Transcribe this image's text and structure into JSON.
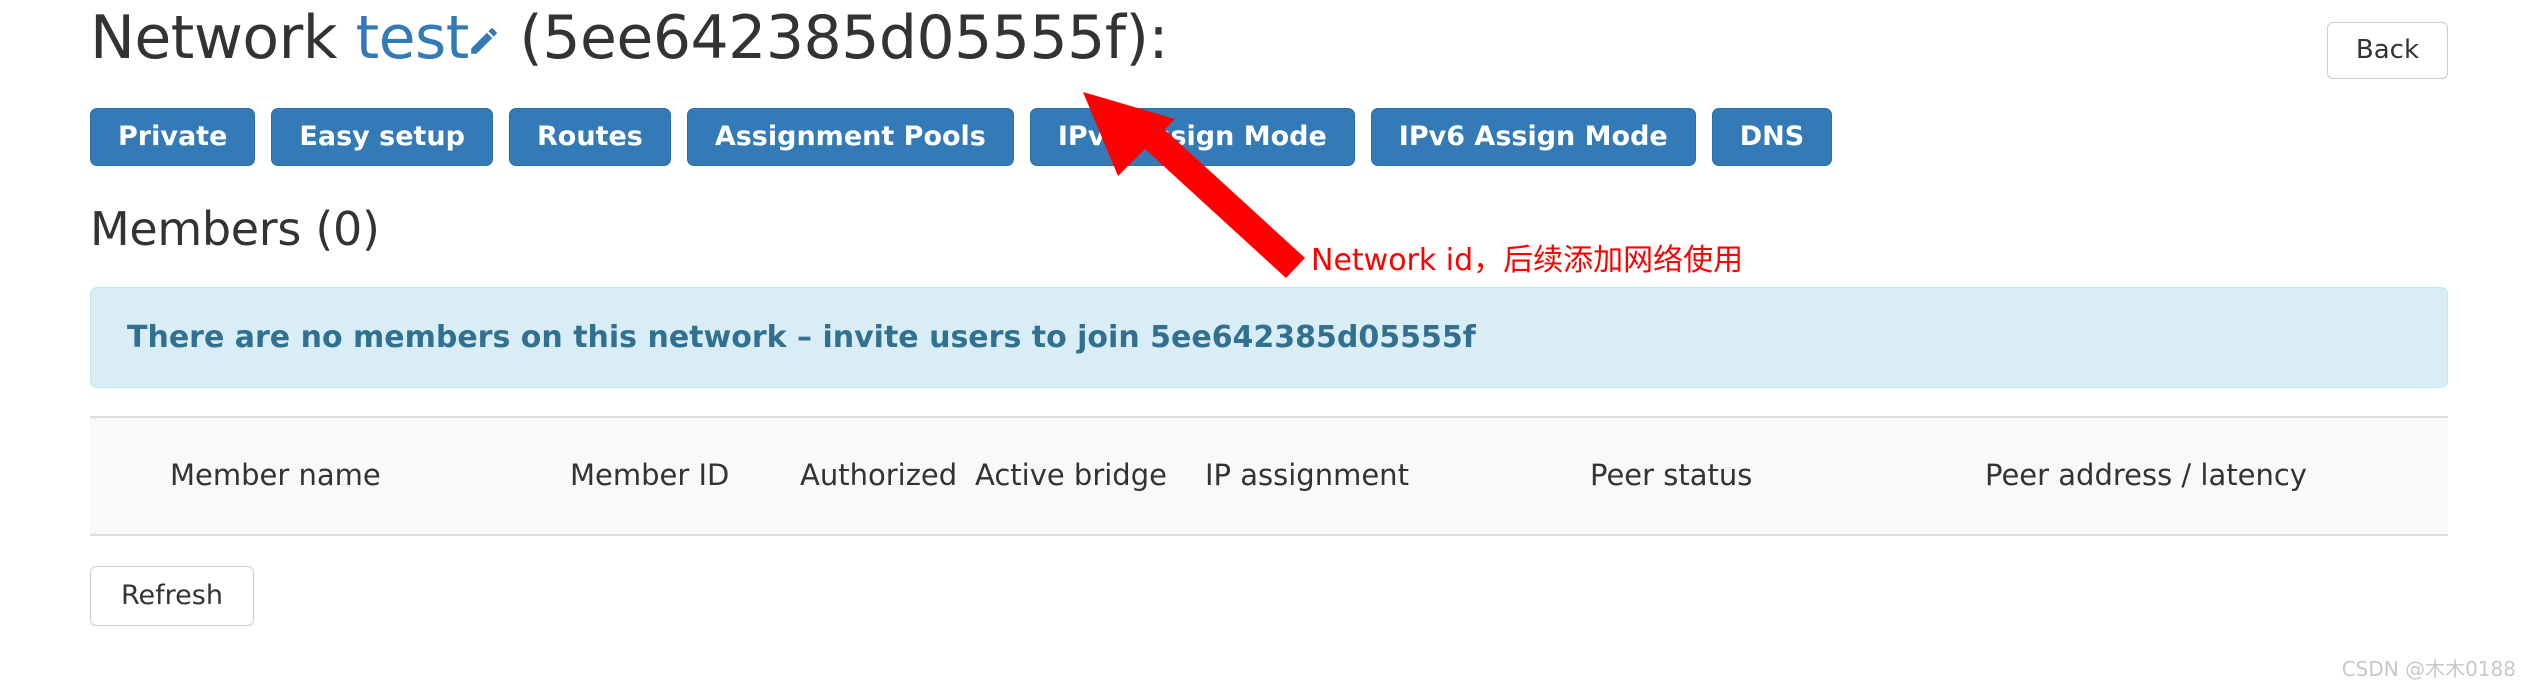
{
  "header": {
    "title_prefix": "Network",
    "network_name": "test",
    "edit_icon": "pencil-icon",
    "network_id_display": "(5ee642385d05555f):",
    "network_id": "5ee642385d05555f",
    "back_label": "Back"
  },
  "tabs": [
    {
      "label": "Private"
    },
    {
      "label": "Easy setup"
    },
    {
      "label": "Routes"
    },
    {
      "label": "Assignment Pools"
    },
    {
      "label": "IPv4 Assign Mode"
    },
    {
      "label": "IPv6 Assign Mode"
    },
    {
      "label": "DNS"
    }
  ],
  "members": {
    "heading": "Members (0)",
    "empty_alert": "There are no members on this network – invite users to join 5ee642385d05555f",
    "columns": [
      {
        "label": "Member name"
      },
      {
        "label": "Member ID"
      },
      {
        "label": "Authorized"
      },
      {
        "label": "Active bridge"
      },
      {
        "label": "IP assignment"
      },
      {
        "label": "Peer status"
      },
      {
        "label": "Peer address / latency"
      }
    ],
    "rows": [],
    "refresh_label": "Refresh"
  },
  "annotation": {
    "text": "Network id，后续添加网络使用",
    "color": "#ff0000",
    "arrow": "red-arrow-icon"
  },
  "watermark": "CSDN @木木0188",
  "colors": {
    "primary_blue": "#337ab7",
    "alert_bg": "#d9edf7",
    "alert_border": "#bce8f1",
    "alert_text": "#31708f",
    "annotation_red": "#ff0000",
    "table_header_bg": "#f9f9f9"
  }
}
